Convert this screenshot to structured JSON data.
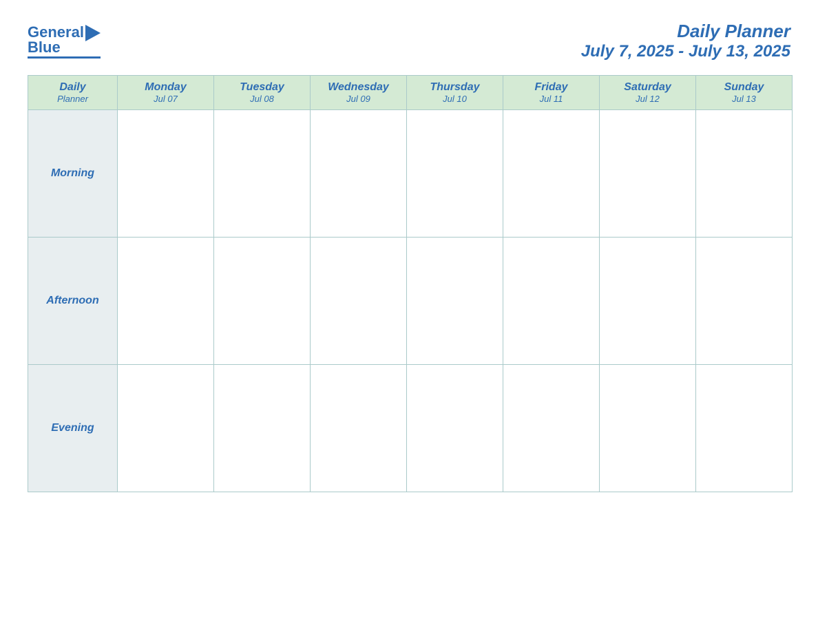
{
  "header": {
    "logo_text1": "General",
    "logo_text2": "Blue",
    "main_title": "Daily Planner",
    "date_range": "July 7, 2025 - July 13, 2025"
  },
  "table": {
    "header_label_line1": "Daily",
    "header_label_line2": "Planner",
    "columns": [
      {
        "day": "Monday",
        "date": "Jul 07"
      },
      {
        "day": "Tuesday",
        "date": "Jul 08"
      },
      {
        "day": "Wednesday",
        "date": "Jul 09"
      },
      {
        "day": "Thursday",
        "date": "Jul 10"
      },
      {
        "day": "Friday",
        "date": "Jul 11"
      },
      {
        "day": "Saturday",
        "date": "Jul 12"
      },
      {
        "day": "Sunday",
        "date": "Jul 13"
      }
    ],
    "rows": [
      {
        "label": "Morning"
      },
      {
        "label": "Afternoon"
      },
      {
        "label": "Evening"
      }
    ]
  }
}
